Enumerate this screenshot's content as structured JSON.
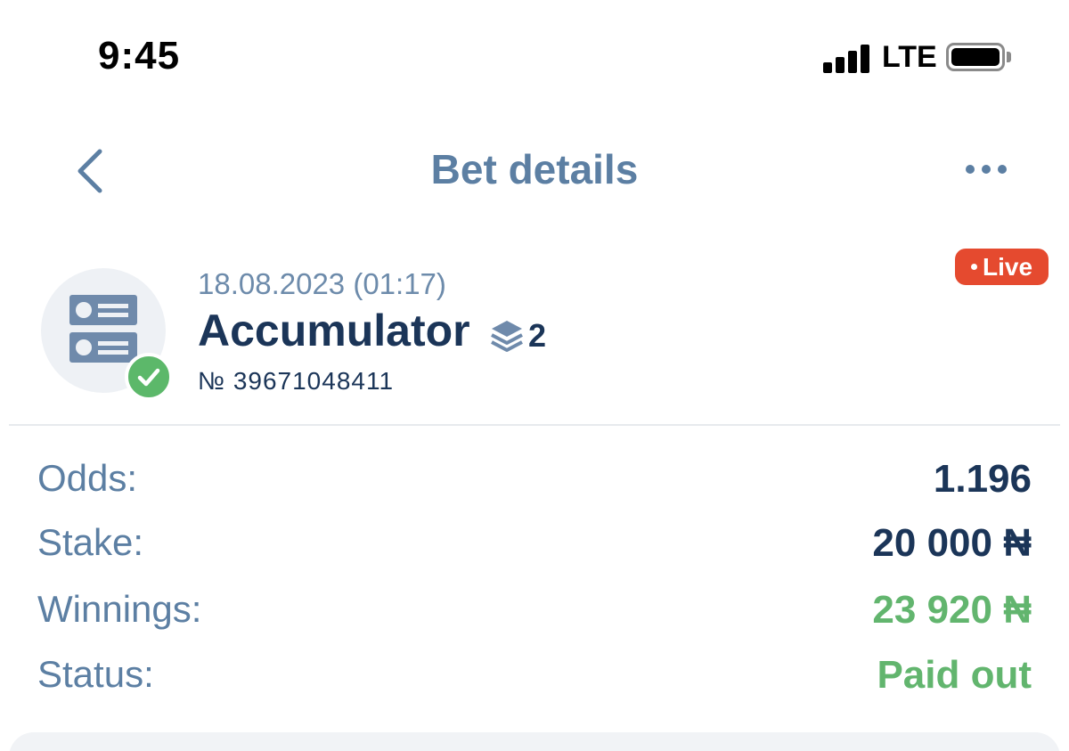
{
  "status_bar": {
    "time": "9:45",
    "network": "LTE",
    "signal_bars": 4,
    "battery_level": 1.0
  },
  "header": {
    "title": "Bet details",
    "back_icon": "chevron-left-icon",
    "more_icon": "more-horizontal-icon"
  },
  "bet": {
    "date": "18.08.2023 (01:17)",
    "type": "Accumulator",
    "selections_count": "2",
    "number": "№ 39671048411",
    "live_label": "Live",
    "icon": "bet-slip-icon",
    "status_icon": "check-icon"
  },
  "details": [
    {
      "label": "Odds:",
      "value": "1.196"
    },
    {
      "label": "Stake:",
      "value": "20 000 ₦"
    },
    {
      "label": "Winnings:",
      "value": "23 920 ₦"
    },
    {
      "label": "Status:",
      "value": "Paid out"
    }
  ],
  "colors": {
    "accent": "#5c7fa3",
    "dark_text": "#1b3558",
    "success": "#62b56e",
    "live": "#e54a2f"
  }
}
